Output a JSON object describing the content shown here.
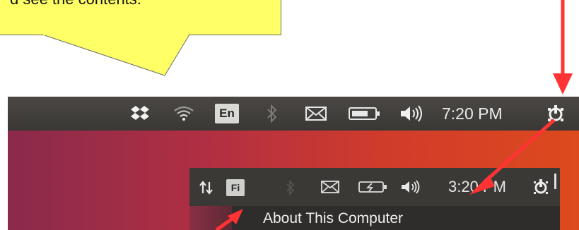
{
  "callout": {
    "text": "d see the contents."
  },
  "panel": {
    "tray_icons": [
      "dropbox-icon",
      "wifi-icon",
      "keyboard-layout-indicator",
      "bluetooth-icon",
      "mail-icon",
      "battery-icon",
      "volume-icon",
      "power-icon"
    ],
    "keyboard_layout": "En",
    "clock": "7:20 PM"
  },
  "zoom_panel": {
    "tray_icons": [
      "network-arrows-icon",
      "keyboard-layout-indicator",
      "bluetooth-icon",
      "mail-icon",
      "battery-charging-icon",
      "volume-icon",
      "power-icon"
    ],
    "keyboard_layout": "Fi",
    "clock": "3:20 PM",
    "menu_item": "About This Computer"
  },
  "colors": {
    "callout": "#ffff66",
    "arrow": "#ff3333",
    "panel": "#3c3a37"
  }
}
